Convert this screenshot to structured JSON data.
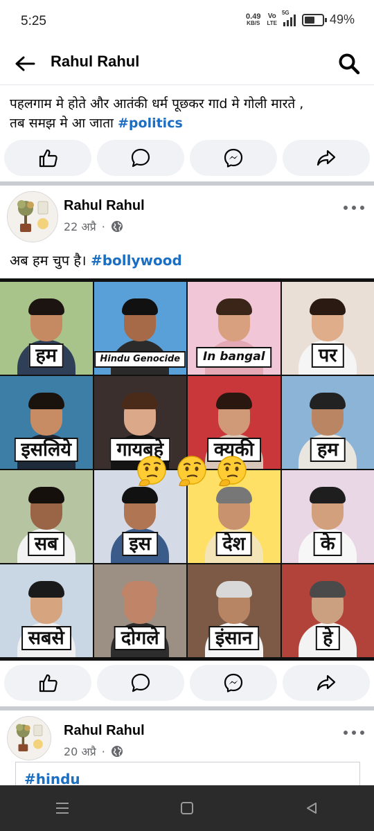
{
  "status_bar": {
    "time": "5:25",
    "net_speed_value": "0.49",
    "net_speed_unit": "KB/S",
    "volte_top": "Vo",
    "volte_bottom": "LTE",
    "network": "5G",
    "battery_percent": "49%",
    "battery_level": 0.49
  },
  "header": {
    "title": "Rahul Rahul",
    "back_icon": "arrow-left-icon",
    "search_icon": "search-icon"
  },
  "post_previous": {
    "text_line1": "पहलगाम मे होते और आतंकी धर्म पूछकर गाd मे गोली मारते ,",
    "text_line2": "तब समझ मे आ जाता ",
    "hashtag": "#politics"
  },
  "actions": {
    "like_icon": "thumbs-up-icon",
    "comment_icon": "comment-icon",
    "messenger_icon": "messenger-icon",
    "share_icon": "share-icon"
  },
  "post_main": {
    "author": "Rahul Rahul",
    "date": "22 अप्रै",
    "separator": "·",
    "privacy_icon": "globe-icon",
    "caption_text": "अब हम चुप है। ",
    "hashtag": "#bollywood",
    "meme_words": [
      "हम",
      "Hindu Genocide",
      "In bangal",
      "पर",
      "इसलिये",
      "गायबहे",
      "क्यकी",
      "हम",
      "सब",
      "इस",
      "देश",
      "के",
      "सबसे",
      "दोगले",
      "इंसान",
      "हे"
    ],
    "emoji": "thinking-face-emoji"
  },
  "post_next": {
    "author": "Rahul Rahul",
    "date": "20 अप्रै",
    "separator": "·",
    "privacy_icon": "globe-icon",
    "hashtag": "#hindu"
  },
  "nav": {
    "recents_icon": "menu-lines-icon",
    "home_icon": "square-home-icon",
    "back_icon": "triangle-back-icon"
  }
}
